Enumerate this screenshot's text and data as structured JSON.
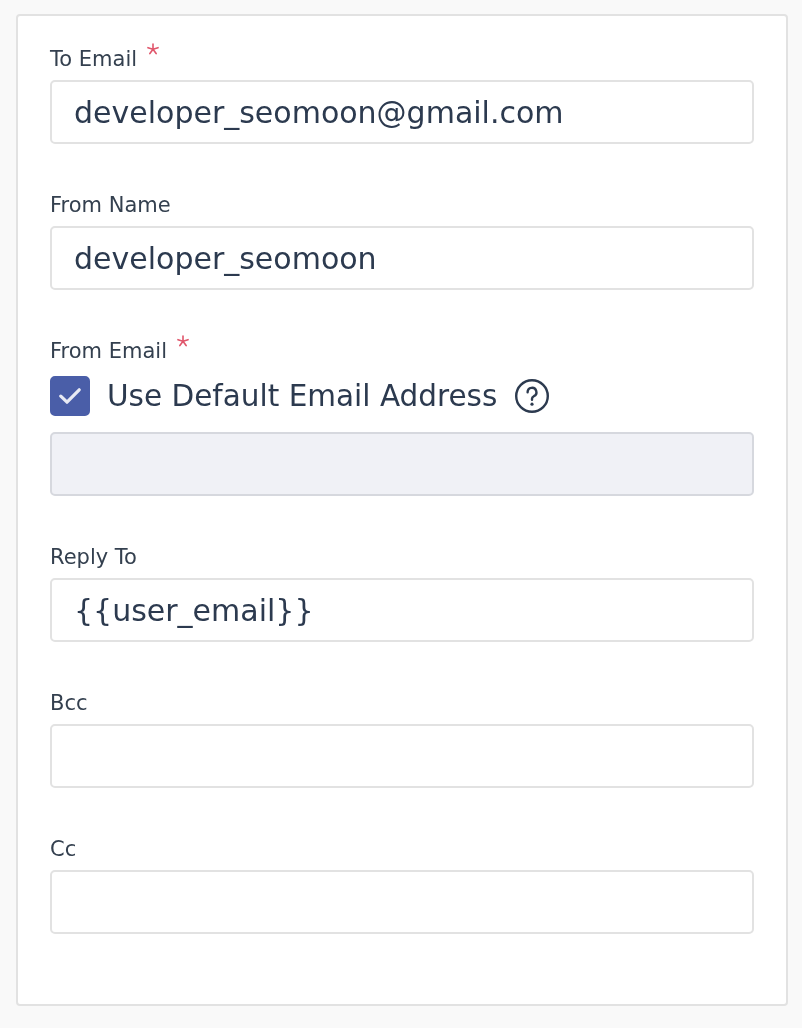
{
  "fields": [
    {
      "kind": "text",
      "label": "To Email",
      "required": true,
      "disabled": false,
      "value": "developer_seomoon@gmail.com"
    },
    {
      "kind": "text",
      "label": "From Name",
      "required": false,
      "disabled": false,
      "value": "developer_seomoon"
    },
    {
      "kind": "checkbox_text",
      "label": "From Email",
      "required": true,
      "disabled": true,
      "checkbox": {
        "label": "Use Default Email Address",
        "checked": true
      }
    },
    {
      "kind": "text",
      "label": "Reply To",
      "required": false,
      "disabled": false,
      "value": "{{user_email}}"
    },
    {
      "kind": "text",
      "label": "Bcc",
      "required": false,
      "disabled": false
    },
    {
      "kind": "text",
      "label": "Cc",
      "required": false,
      "disabled": false
    }
  ]
}
